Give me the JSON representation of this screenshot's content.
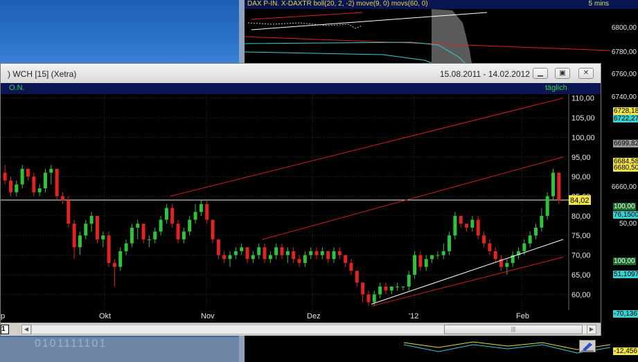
{
  "background_window": {
    "title": "DAX P-IN.  X-DAXTR boll(20, 2, -2) move(9, 0) movs(60, 0)",
    "interval": "5 mins",
    "price_ticks": [
      "6800,00",
      "6780,00",
      "6760,00",
      "6740,00",
      "6660,00"
    ],
    "price_labels": [
      {
        "text": "6728,18",
        "color": "#f0e44a"
      },
      {
        "text": "6722,27",
        "color": "#39d0d0"
      },
      {
        "text": "6699,82",
        "color": "#9a9a9a"
      },
      {
        "text": "6684,58",
        "color": "#f0e44a"
      },
      {
        "text": "6680,50",
        "color": "#f0e44a"
      }
    ],
    "indicator_values": [
      {
        "text": "100,00",
        "color": "#1f6b2a"
      },
      {
        "text": "76,1500",
        "color": "#39d0d0"
      },
      {
        "text": "50,00",
        "color": "#000000"
      },
      {
        "text": "100,00",
        "color": "#1f6b2a"
      },
      {
        "text": "51,1097",
        "color": "#39d0d0"
      },
      {
        "text": "-70,1367",
        "color": "#39d0d0"
      },
      {
        "text": "-12,456",
        "color": "#f0e44a"
      }
    ]
  },
  "desktop_text": "0101111101",
  "window": {
    "title": ") WCH [15] (Xetra)",
    "date_range": "15.08.2011 - 14.02.2012",
    "buttons": {
      "minimize": "▁",
      "restore": "▣",
      "close": "✕"
    },
    "indicator_label": "O.N.",
    "period_label": "täglich",
    "tab_label": "1",
    "scroll_glyph": "|||"
  },
  "chart_data": {
    "type": "candlestick",
    "title": "",
    "xlabel": "",
    "ylabel": "",
    "ylim": [
      56,
      111
    ],
    "yticks": [
      "110,00",
      "105,00",
      "100,00",
      "95,00",
      "90,00",
      "85,00",
      "80,00",
      "75,00",
      "70,00",
      "65,00",
      "60,00"
    ],
    "x_labels": [
      "p",
      "Okt",
      "Nov",
      "Dez",
      "'12",
      "Feb"
    ],
    "current_price": {
      "value": 84.02,
      "label": "84,02"
    },
    "grid": true,
    "candles": [
      [
        91,
        93,
        88,
        89
      ],
      [
        89,
        90,
        85,
        86
      ],
      [
        86,
        89,
        85,
        88
      ],
      [
        88,
        93,
        87,
        92
      ],
      [
        92,
        92,
        89,
        90
      ],
      [
        90,
        91,
        85,
        86
      ],
      [
        86,
        88,
        85,
        87
      ],
      [
        87,
        92,
        86,
        91
      ],
      [
        91,
        93,
        88,
        92
      ],
      [
        92,
        92,
        84,
        85
      ],
      [
        85,
        86,
        83,
        84
      ],
      [
        84,
        85,
        77,
        78
      ],
      [
        78,
        79,
        69,
        72
      ],
      [
        72,
        76,
        70,
        75
      ],
      [
        75,
        79,
        74,
        78
      ],
      [
        78,
        81,
        76,
        80
      ],
      [
        80,
        80,
        73,
        74
      ],
      [
        74,
        76,
        72,
        75
      ],
      [
        75,
        76,
        67,
        68
      ],
      [
        68,
        69,
        62,
        67
      ],
      [
        67,
        72,
        66,
        71
      ],
      [
        71,
        74,
        70,
        73
      ],
      [
        73,
        78,
        72,
        77
      ],
      [
        77,
        79,
        74,
        78
      ],
      [
        78,
        78,
        73,
        74
      ],
      [
        74,
        75,
        72,
        74
      ],
      [
        74,
        77,
        73,
        76
      ],
      [
        76,
        80,
        75,
        79
      ],
      [
        79,
        83,
        78,
        82
      ],
      [
        82,
        83,
        77,
        78
      ],
      [
        78,
        79,
        73,
        74
      ],
      [
        74,
        77,
        73,
        76
      ],
      [
        76,
        80,
        75,
        79
      ],
      [
        79,
        83,
        78,
        81
      ],
      [
        81,
        84,
        80,
        83
      ],
      [
        83,
        84,
        78,
        79
      ],
      [
        79,
        79,
        73,
        74
      ],
      [
        74,
        74,
        69,
        70
      ],
      [
        70,
        71,
        68,
        69
      ],
      [
        69,
        71,
        67,
        70
      ],
      [
        70,
        72,
        69,
        71
      ],
      [
        71,
        73,
        70,
        72
      ],
      [
        72,
        72,
        68,
        69
      ],
      [
        69,
        71,
        68,
        70
      ],
      [
        70,
        73,
        69,
        72
      ],
      [
        72,
        73,
        68,
        69
      ],
      [
        69,
        71,
        68,
        70
      ],
      [
        70,
        73,
        69,
        72
      ],
      [
        72,
        73,
        69,
        70
      ],
      [
        70,
        72,
        68,
        71
      ],
      [
        71,
        72,
        68,
        69
      ],
      [
        69,
        70,
        67,
        68
      ],
      [
        68,
        71,
        67,
        70
      ],
      [
        70,
        72,
        69,
        71
      ],
      [
        71,
        72,
        69,
        70
      ],
      [
        70,
        72,
        69,
        71
      ],
      [
        71,
        71,
        68,
        69
      ],
      [
        69,
        72,
        68,
        71
      ],
      [
        71,
        72,
        69,
        70
      ],
      [
        70,
        70,
        67,
        68
      ],
      [
        68,
        69,
        65,
        66
      ],
      [
        66,
        66,
        62,
        63
      ],
      [
        63,
        63,
        58,
        60
      ],
      [
        60,
        61,
        57,
        58
      ],
      [
        58,
        61,
        57,
        60
      ],
      [
        60,
        63,
        59,
        62
      ],
      [
        62,
        63,
        60,
        61
      ],
      [
        61,
        62,
        60,
        62
      ],
      [
        62,
        63,
        61,
        62
      ],
      [
        62,
        62,
        61,
        62
      ],
      [
        62,
        66,
        61,
        65
      ],
      [
        65,
        71,
        64,
        70
      ],
      [
        70,
        71,
        66,
        67
      ],
      [
        67,
        70,
        66,
        69
      ],
      [
        69,
        70,
        68,
        70
      ],
      [
        70,
        71,
        69,
        70
      ],
      [
        70,
        73,
        69,
        71
      ],
      [
        71,
        76,
        70,
        75
      ],
      [
        75,
        81,
        74,
        80
      ],
      [
        80,
        80,
        77,
        78
      ],
      [
        78,
        78,
        76,
        77
      ],
      [
        77,
        80,
        76,
        79
      ],
      [
        79,
        80,
        74,
        75
      ],
      [
        75,
        76,
        72,
        73
      ],
      [
        73,
        74,
        70,
        71
      ],
      [
        71,
        72,
        68,
        69
      ],
      [
        69,
        70,
        66,
        67
      ],
      [
        67,
        69,
        65,
        68
      ],
      [
        68,
        71,
        67,
        70
      ],
      [
        70,
        72,
        69,
        71
      ],
      [
        71,
        74,
        70,
        73
      ],
      [
        73,
        76,
        72,
        75
      ],
      [
        75,
        78,
        74,
        77
      ],
      [
        77,
        82,
        76,
        80
      ],
      [
        80,
        86,
        79,
        85
      ],
      [
        85,
        92,
        84,
        91
      ],
      [
        91,
        91,
        83,
        84
      ]
    ]
  }
}
